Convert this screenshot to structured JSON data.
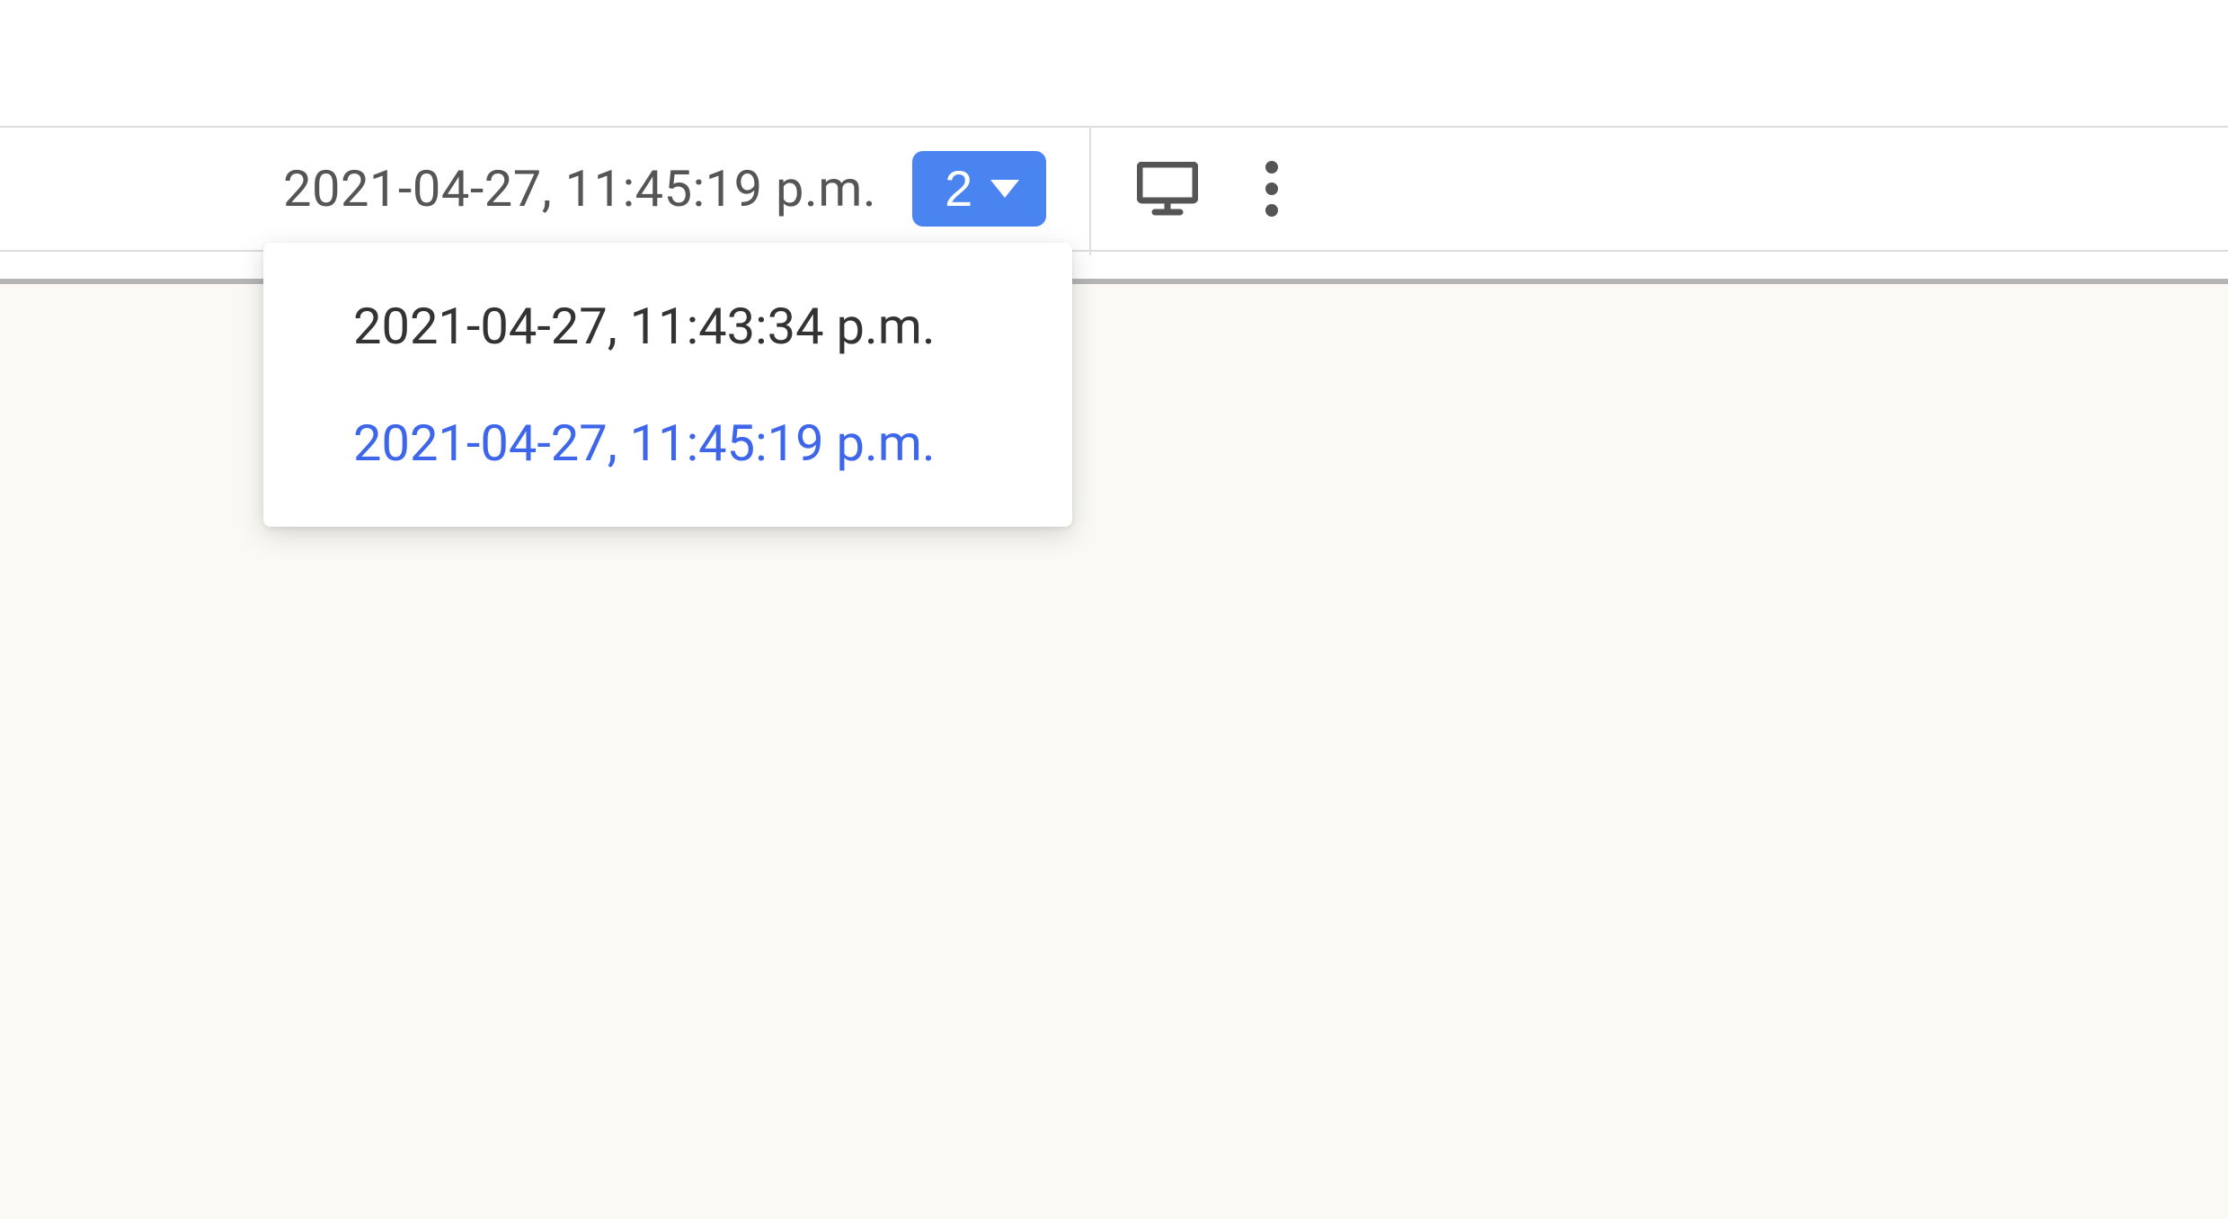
{
  "toolbar": {
    "timestamp": "2021-04-27, 11:45:19 p.m.",
    "count": "2"
  },
  "dropdown": {
    "items": [
      {
        "label": "2021-04-27, 11:43:34 p.m.",
        "selected": false
      },
      {
        "label": "2021-04-27, 11:45:19 p.m.",
        "selected": true
      }
    ]
  }
}
